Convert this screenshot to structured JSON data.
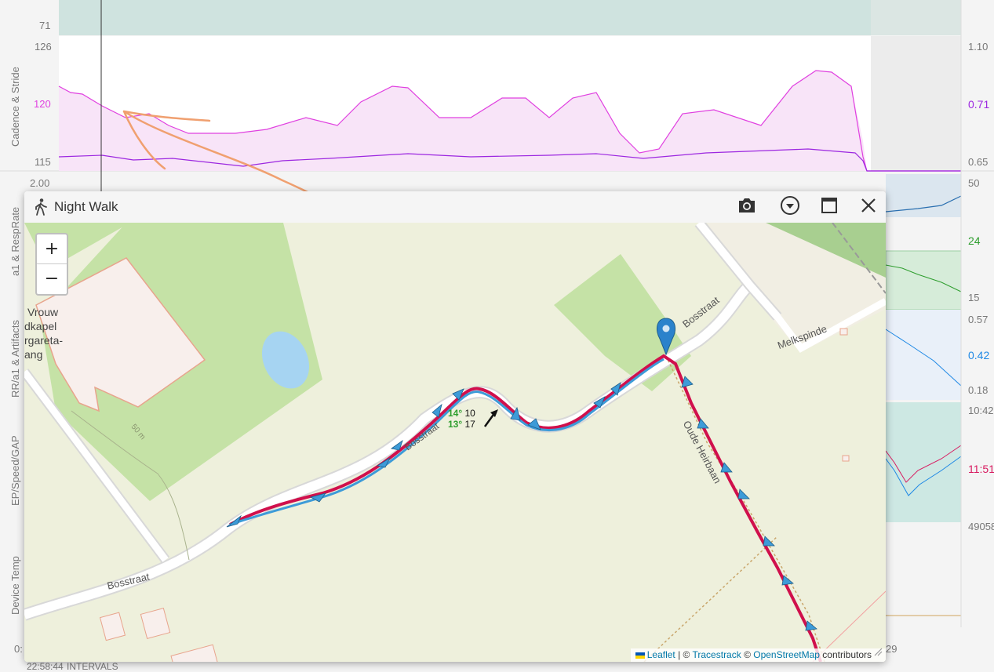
{
  "colors": {
    "cadence": "#e040e0",
    "stride": "#9c27e0",
    "resp": "#2e9e2e",
    "rr": "#1e88e5",
    "pace": "#d81b60",
    "track_red": "#d0104c",
    "track_blue": "#3d9bd8"
  },
  "chart": {
    "left_ticks": {
      "t71": "71",
      "t126": "126",
      "t120": "120",
      "t115": "115",
      "t200": "2.00"
    },
    "right_ticks": {
      "r110": "1.10",
      "r071": "0.71",
      "r065": "0.65",
      "r50": "50",
      "r24": "24",
      "r15": "15",
      "r057": "0.57",
      "r042": "0.42",
      "r018": "0.18",
      "r1042": "10:42",
      "r1151": "11:51",
      "r4905": "49058"
    },
    "panel_labels": {
      "cadence": "Cadence & Stride",
      "a1resp": "a1 & RespRate",
      "rr": "RR/a1 & Artifacts",
      "ep": "EP/Speed/GAP",
      "temp": "Device Temp"
    },
    "bottom_left": "0:",
    "bottom_time": "22:58:44",
    "intervals_label": "INTERVALS",
    "right_axis_end": "29"
  },
  "popup": {
    "title": "Night Walk",
    "activity_icon": "walking-person-icon",
    "buttons": {
      "camera": "camera-icon",
      "dropdown": "chevron-circle-down-icon",
      "maximize": "maximize-icon",
      "close": "close-icon"
    }
  },
  "map": {
    "zoom_in": "+",
    "zoom_out": "−",
    "labels": {
      "church1": "Vrouw",
      "church2": "dkapel",
      "church3": "rgareta-",
      "church4": "ang",
      "bosstraat_top": "Bosstraat",
      "bosstraat_mid": "Bosstraat",
      "bosstraat_bottom": "Bosstraat",
      "melkspinde": "Melkspinde",
      "oude": "Oude Heirbaan",
      "contour": "50 m"
    },
    "weather": {
      "temp1": "14°",
      "wind1": "10",
      "temp2": "13°",
      "wind2": "17"
    },
    "attribution": {
      "leaflet": "Leaflet",
      "sep1": " | © ",
      "tracestrack": "Tracestrack",
      "sep2": " © ",
      "osm": "OpenStreetMap",
      "contrib": " contributors"
    }
  }
}
